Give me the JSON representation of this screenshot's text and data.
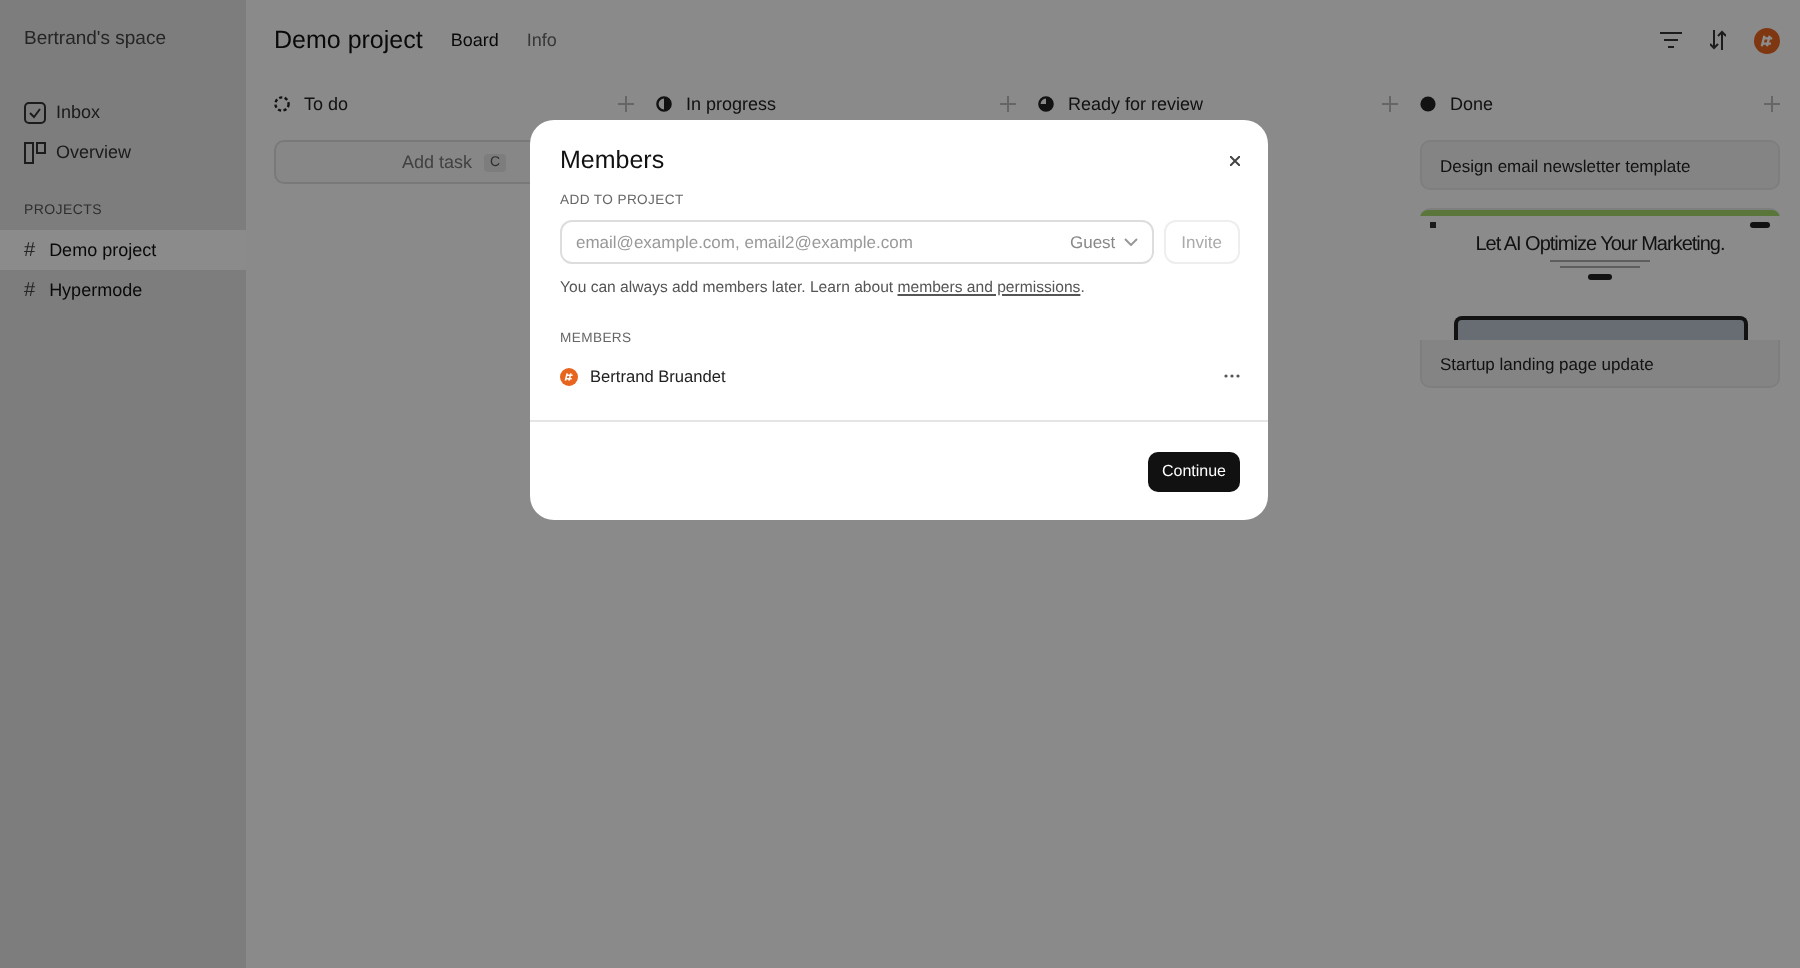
{
  "sidebar": {
    "workspace": "Bertrand's space",
    "items": [
      {
        "label": "Inbox",
        "kind": "inbox"
      },
      {
        "label": "Overview",
        "kind": "overview"
      }
    ],
    "section": "PROJECTS",
    "projects": [
      {
        "icon": "#",
        "label": "Demo project",
        "selected": true
      },
      {
        "icon": "#",
        "label": "Hypermode",
        "selected": false
      }
    ]
  },
  "header": {
    "title": "Demo project",
    "tabs": [
      {
        "label": "Board",
        "selected": true
      },
      {
        "label": "Info",
        "selected": false
      }
    ]
  },
  "columns": [
    {
      "title": "To do",
      "kind": "todo",
      "add_task": {
        "label": "Add task",
        "shortcut": "C"
      }
    },
    {
      "title": "In progress",
      "kind": "progress"
    },
    {
      "title": "Ready for review",
      "kind": "review"
    },
    {
      "title": "Done",
      "kind": "done",
      "cards": [
        {
          "title": "Design email newsletter template"
        },
        {
          "title": "Startup landing page update",
          "preview": {
            "headline": "Let AI Optimize Your Marketing."
          }
        }
      ]
    }
  ],
  "dialog": {
    "title": "Members",
    "add_label": "ADD TO PROJECT",
    "placeholder": "email@example.com, email2@example.com",
    "role": "Guest",
    "invite": {
      "label": "Invite",
      "disabled": true
    },
    "note_before": "You can always add members later. Learn about ",
    "note_link": "members and permissions",
    "note_after": ".",
    "members_label": "MEMBERS",
    "members": [
      {
        "name": "Bertrand Bruandet"
      }
    ],
    "continue": "Continue"
  }
}
